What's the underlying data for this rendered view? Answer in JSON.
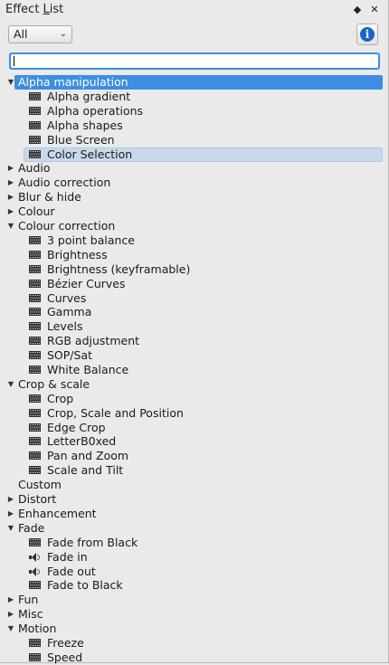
{
  "window": {
    "title_prefix": "Effect ",
    "title_underlined": "L",
    "title_suffix": "ist",
    "float_icon": "◆",
    "close_icon": "✕"
  },
  "filter": {
    "selected": "All",
    "chevron": "⌄"
  },
  "info_button": {
    "glyph": "i"
  },
  "search": {
    "value": ""
  },
  "tree": [
    {
      "label": "Alpha manipulation",
      "expanded": true,
      "selected": true,
      "items": [
        {
          "label": "Alpha gradient",
          "icon": "film-icon"
        },
        {
          "label": "Alpha operations",
          "icon": "film-icon"
        },
        {
          "label": "Alpha shapes",
          "icon": "film-icon"
        },
        {
          "label": "Blue Screen",
          "icon": "film-icon"
        },
        {
          "label": "Color Selection",
          "icon": "film-icon",
          "highlighted": true
        }
      ]
    },
    {
      "label": "Audio",
      "expanded": false,
      "items": []
    },
    {
      "label": "Audio correction",
      "expanded": false,
      "items": []
    },
    {
      "label": "Blur & hide",
      "expanded": false,
      "items": []
    },
    {
      "label": "Colour",
      "expanded": false,
      "items": []
    },
    {
      "label": "Colour correction",
      "expanded": true,
      "items": [
        {
          "label": "3 point balance",
          "icon": "film-icon"
        },
        {
          "label": "Brightness",
          "icon": "film-icon"
        },
        {
          "label": "Brightness (keyframable)",
          "icon": "film-icon"
        },
        {
          "label": "Bézier Curves",
          "icon": "film-icon"
        },
        {
          "label": "Curves",
          "icon": "film-icon"
        },
        {
          "label": "Gamma",
          "icon": "film-icon"
        },
        {
          "label": "Levels",
          "icon": "film-icon"
        },
        {
          "label": "RGB adjustment",
          "icon": "film-icon"
        },
        {
          "label": "SOP/Sat",
          "icon": "film-icon"
        },
        {
          "label": "White Balance",
          "icon": "film-icon"
        }
      ]
    },
    {
      "label": "Crop & scale",
      "expanded": true,
      "items": [
        {
          "label": "Crop",
          "icon": "film-icon"
        },
        {
          "label": "Crop, Scale and Position",
          "icon": "film-icon"
        },
        {
          "label": "Edge Crop",
          "icon": "film-icon"
        },
        {
          "label": "LetterB0xed",
          "icon": "film-icon"
        },
        {
          "label": "Pan and Zoom",
          "icon": "film-icon"
        },
        {
          "label": "Scale and Tilt",
          "icon": "film-icon"
        }
      ]
    },
    {
      "label": "Custom",
      "expanded": null,
      "items": []
    },
    {
      "label": "Distort",
      "expanded": false,
      "items": []
    },
    {
      "label": "Enhancement",
      "expanded": false,
      "items": []
    },
    {
      "label": "Fade",
      "expanded": true,
      "items": [
        {
          "label": "Fade from Black",
          "icon": "film-icon"
        },
        {
          "label": "Fade in",
          "icon": "speaker-icon"
        },
        {
          "label": "Fade out",
          "icon": "speaker-icon"
        },
        {
          "label": "Fade to Black",
          "icon": "film-icon"
        }
      ]
    },
    {
      "label": "Fun",
      "expanded": false,
      "items": []
    },
    {
      "label": "Misc",
      "expanded": false,
      "items": []
    },
    {
      "label": "Motion",
      "expanded": true,
      "items": [
        {
          "label": "Freeze",
          "icon": "film-icon"
        },
        {
          "label": "Speed",
          "icon": "film-icon"
        }
      ]
    }
  ]
}
